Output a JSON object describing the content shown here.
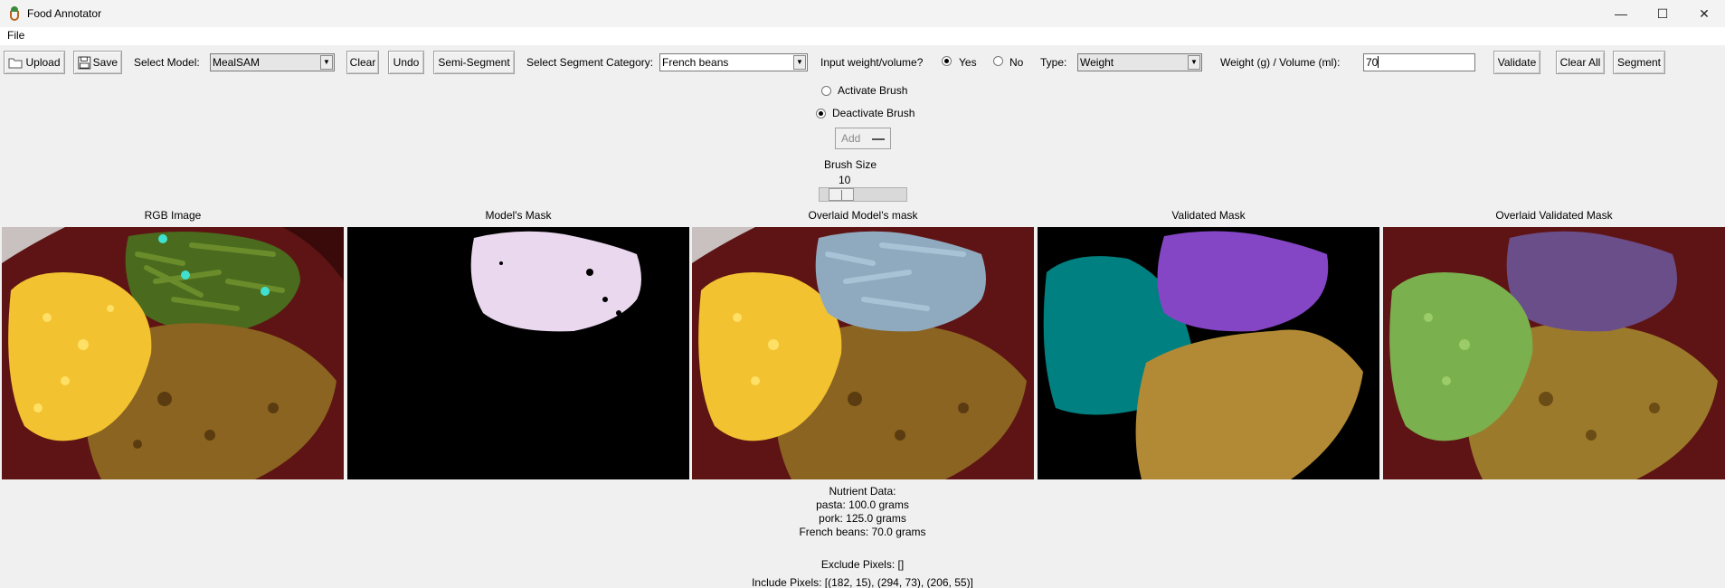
{
  "window": {
    "title": "Food Annotator",
    "minimize_icon": "minimize-icon",
    "maximize_icon": "maximize-icon",
    "close_icon": "close-icon"
  },
  "menu": {
    "file": "File"
  },
  "toolbar": {
    "upload": "Upload",
    "save": "Save",
    "select_model_label": "Select Model:",
    "model_value": "MealSAM",
    "clear": "Clear",
    "undo": "Undo",
    "semi_segment": "Semi-Segment",
    "select_category_label": "Select Segment Category:",
    "category_value": "French beans",
    "input_weight_label": "Input weight/volume?",
    "yes": "Yes",
    "no": "No",
    "yes_selected": true,
    "type_label": "Type:",
    "type_value": "Weight",
    "weight_label": "Weight (g) / Volume (ml):",
    "weight_value": "70",
    "validate": "Validate",
    "clear_all": "Clear All",
    "segment": "Segment"
  },
  "brush": {
    "activate": "Activate Brush",
    "deactivate": "Deactivate Brush",
    "active": false,
    "add_button": "Add",
    "size_label": "Brush Size",
    "size_value": "10"
  },
  "panels": [
    {
      "title": "RGB Image"
    },
    {
      "title": "Model's Mask"
    },
    {
      "title": "Overlaid Model's mask"
    },
    {
      "title": "Validated Mask"
    },
    {
      "title": "Overlaid Validated Mask"
    }
  ],
  "colors": {
    "plate": "#5e1414",
    "pasta": "#f2c230",
    "beans": "#4a6a1e",
    "pork": "#8a6420",
    "model_mask": "#ead8ee",
    "teal_mask": "#008080",
    "purple_mask": "#8446c4",
    "gold_mask": "#b28a35",
    "click_point": "#40e0d0"
  },
  "nutrient": {
    "heading": "Nutrient Data:",
    "lines": [
      "pasta: 100.0 grams",
      "pork: 125.0 grams",
      "French beans: 70.0 grams"
    ]
  },
  "pixels": {
    "exclude": "Exclude Pixels: []",
    "include": "Include Pixels: [(182, 15), (294, 73), (206, 55)]"
  }
}
